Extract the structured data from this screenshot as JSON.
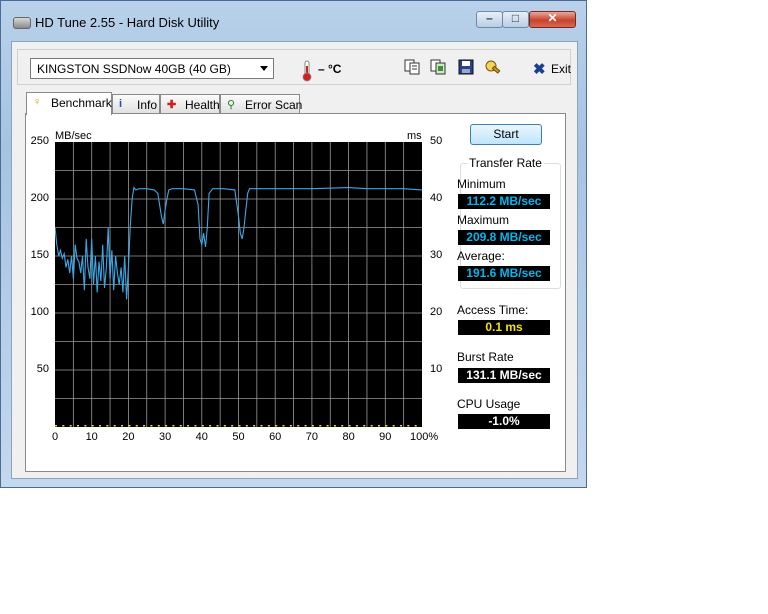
{
  "window": {
    "title": "HD Tune 2.55 - Hard Disk Utility",
    "min_glyph": "–",
    "max_glyph": "□",
    "close_glyph": "✕"
  },
  "toolbar": {
    "drive": "KINGSTON SSDNow 40GB (40 GB)",
    "temperature": "– °C",
    "exit_label": "Exit",
    "icons": [
      "copy-info-icon",
      "copy-screenshot-icon",
      "save-icon",
      "options-icon",
      "exit-icon"
    ]
  },
  "tabs": [
    {
      "label": "Benchmark",
      "icon": "benchmark-icon",
      "active": true
    },
    {
      "label": "Info",
      "icon": "info-icon",
      "active": false
    },
    {
      "label": "Health",
      "icon": "health-icon",
      "active": false
    },
    {
      "label": "Error Scan",
      "icon": "error-scan-icon",
      "active": false
    }
  ],
  "benchmark": {
    "start_label": "Start",
    "transfer_rate_title": "Transfer Rate",
    "minimum_label": "Minimum",
    "minimum_value": "112.2 MB/sec",
    "maximum_label": "Maximum",
    "maximum_value": "209.8 MB/sec",
    "average_label": "Average:",
    "average_value": "191.6 MB/sec",
    "access_time_label": "Access Time:",
    "access_time_value": "0.1 ms",
    "burst_rate_label": "Burst Rate",
    "burst_rate_value": "131.1 MB/sec",
    "cpu_usage_label": "CPU Usage",
    "cpu_usage_value": "-1.0%"
  },
  "colors": {
    "transfer_line": "#3aa8e8",
    "access_points": "#f5e200",
    "grid": "#9a9a9a",
    "plot_bg": "#000000"
  },
  "chart_data": {
    "type": "line",
    "ylabel_left": "MB/sec",
    "ylabel_right": "ms",
    "ylim_left": [
      0,
      250
    ],
    "ylim_right": [
      0,
      50
    ],
    "xlim": [
      0,
      100
    ],
    "y_ticks_left": [
      "250",
      "200",
      "150",
      "100",
      "50"
    ],
    "y_ticks_right": [
      "50",
      "40",
      "30",
      "20",
      "10"
    ],
    "x_ticks": [
      "0",
      "10",
      "20",
      "30",
      "40",
      "50",
      "60",
      "70",
      "80",
      "90",
      "100%"
    ],
    "grid": true,
    "series": [
      {
        "name": "Transfer Rate",
        "x": [
          0,
          0.5,
          1,
          1.5,
          2,
          2.5,
          3,
          3.5,
          4,
          4.5,
          5,
          5.5,
          6,
          6.5,
          7,
          7.5,
          8,
          8.5,
          9,
          9.5,
          10,
          10.5,
          11,
          11.5,
          12,
          12.5,
          13,
          13.5,
          14,
          14.5,
          15,
          15.5,
          16,
          16.5,
          17,
          17.5,
          18,
          18.5,
          19,
          19.5,
          20,
          20.5,
          21,
          21.5,
          22,
          23,
          25,
          27,
          28,
          29,
          29.5,
          30,
          30.5,
          31,
          32,
          35,
          38,
          39,
          39.5,
          40,
          40.5,
          41,
          41.5,
          42,
          43,
          46,
          49,
          50,
          50.5,
          51,
          51.5,
          52,
          52.5,
          53,
          55,
          60,
          70,
          80,
          85,
          90,
          95,
          100
        ],
        "y": [
          175,
          160,
          150,
          155,
          148,
          152,
          140,
          147,
          135,
          150,
          130,
          160,
          148,
          145,
          135,
          150,
          120,
          165,
          140,
          130,
          165,
          125,
          150,
          118,
          145,
          128,
          160,
          122,
          140,
          175,
          130,
          155,
          120,
          150,
          135,
          125,
          140,
          118,
          150,
          112,
          140,
          175,
          200,
          210,
          208,
          209,
          209,
          208,
          205,
          185,
          178,
          190,
          200,
          208,
          209,
          209,
          208,
          195,
          165,
          160,
          170,
          158,
          175,
          205,
          209,
          209,
          208,
          185,
          170,
          165,
          175,
          190,
          205,
          209,
          209,
          209,
          209,
          210,
          209,
          209,
          209,
          208
        ]
      }
    ]
  }
}
